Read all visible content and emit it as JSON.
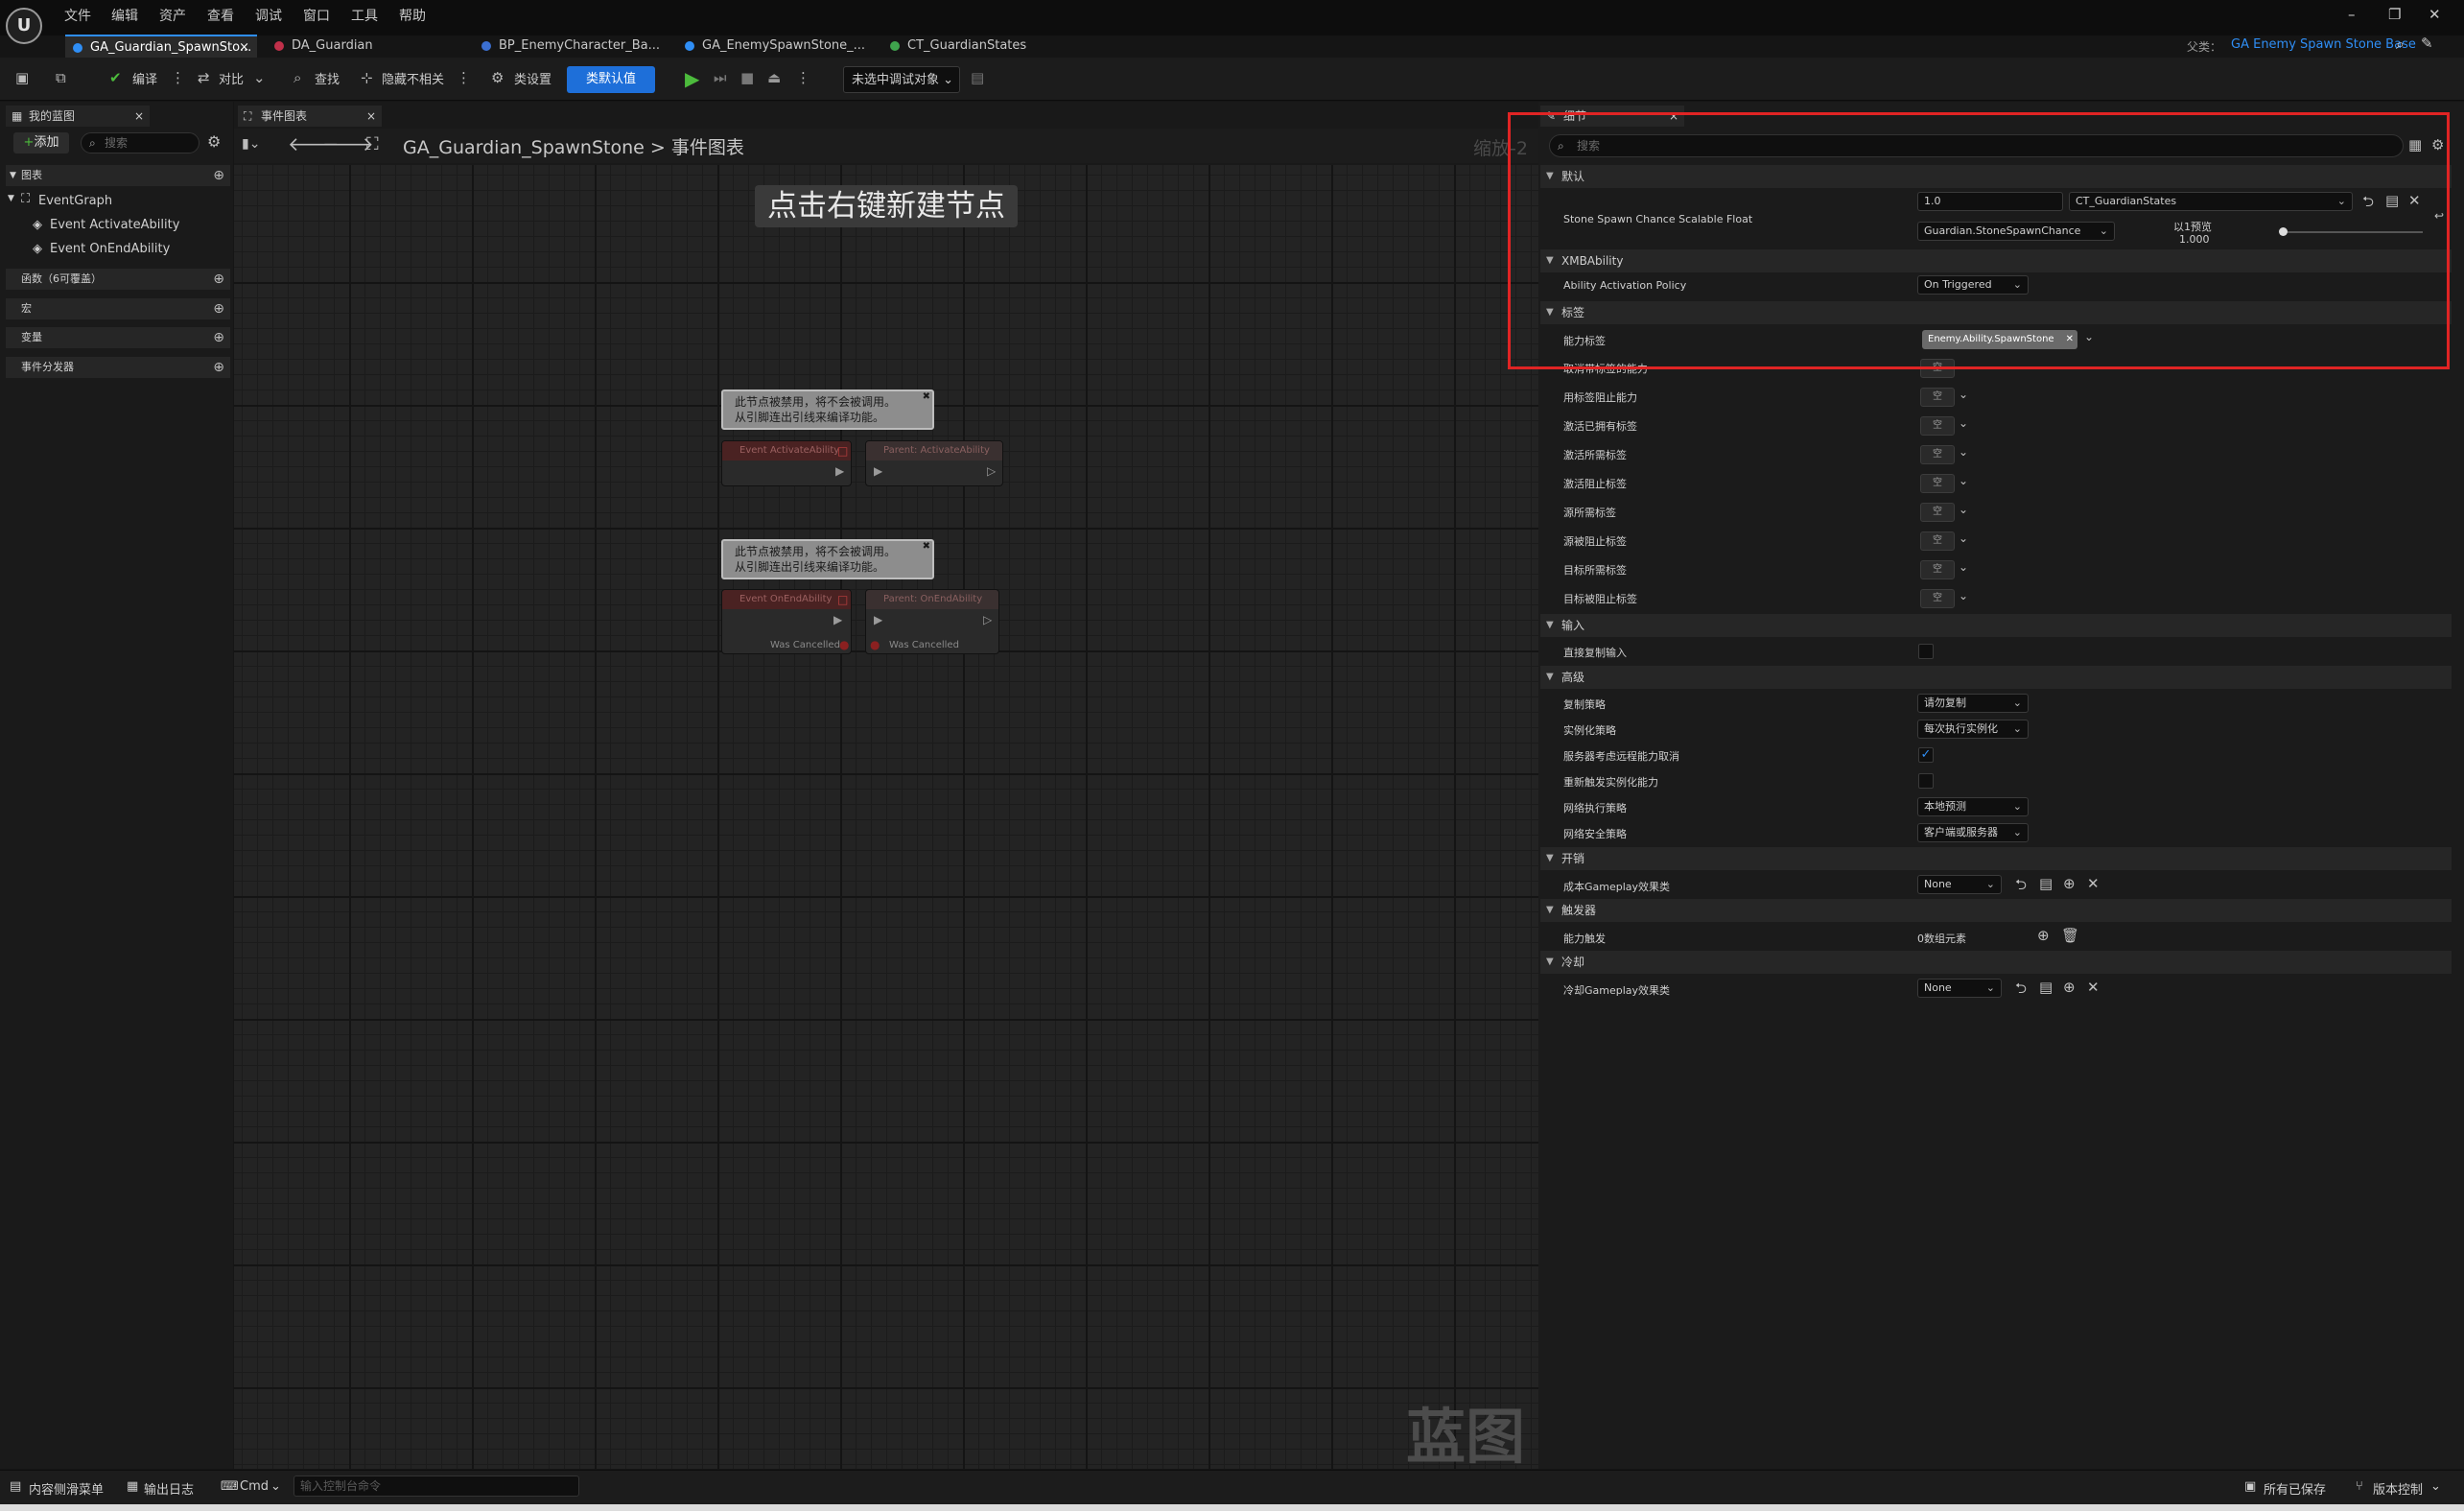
{
  "menu": [
    "文件",
    "编辑",
    "资产",
    "查看",
    "调试",
    "窗口",
    "工具",
    "帮助"
  ],
  "tabs": [
    {
      "label": "GA_Guardian_SpawnSto...",
      "close": "×"
    },
    {
      "label": "DA_Guardian"
    },
    {
      "label": "BP_EnemyCharacter_Ba..."
    },
    {
      "label": "GA_EnemySpawnStone_..."
    },
    {
      "label": "CT_GuardianStates"
    }
  ],
  "parent": {
    "label": "父类：",
    "value": "GA Enemy Spawn Stone Base"
  },
  "toolbar": {
    "compile": "编译",
    "diff": "对比",
    "find": "查找",
    "hide_unrelated": "隐藏不相关",
    "class_settings": "类设置",
    "class_defaults": "类默认值",
    "debug_target": "未选中调试对象"
  },
  "left": {
    "tab": "我的蓝图",
    "add": "添加",
    "search_placeholder": "搜索",
    "graphs": "图表",
    "event_graph": "EventGraph",
    "events": [
      "Event ActivateAbility",
      "Event OnEndAbility"
    ],
    "functions": "函数（6可覆盖）",
    "macros": "宏",
    "variables": "变量",
    "dispatchers": "事件分发器"
  },
  "graph": {
    "tab": "事件图表",
    "breadcrumb_bp": "GA_Guardian_SpawnStone",
    "breadcrumb_sep": ">",
    "breadcrumb_graph": "事件图表",
    "zoom": "缩放-2",
    "hint": "点击右键新建节点",
    "watermark": "蓝图",
    "comment_line1": "此节点被禁用，将不会被调用。",
    "comment_line2": "从引脚连出引线来编译功能。",
    "node1": "Event ActivateAbility",
    "node2": "Parent: ActivateAbility",
    "node3": "Event OnEndAbility",
    "node4": "Parent: OnEndAbility",
    "was_cancelled": "Was Cancelled"
  },
  "details": {
    "tab": "细节",
    "search_placeholder": "搜索",
    "sec_default": "默认",
    "stone_label": "Stone Spawn Chance Scalable Float",
    "stone_value": "1.0",
    "curve_table": "CT_GuardianStates",
    "curve_row": "Guardian.StoneSpawnChance",
    "preview_label": "以1预览",
    "preview_value": "1.000",
    "sec_xmb": "XMBAbility",
    "policy_label": "Ability Activation Policy",
    "policy_value": "On Triggered",
    "sec_tags": "标签",
    "ability_tags_label": "能力标签",
    "ability_tag_value": "Enemy.Ability.SpawnStone",
    "tag_rows": [
      "取消带标签的能力",
      "用标签阻止能力",
      "激活已拥有标签",
      "激活所需标签",
      "激活阻止标签",
      "源所需标签",
      "源被阻止标签",
      "目标所需标签",
      "目标被阻止标签"
    ],
    "empty": "空",
    "sec_input": "输入",
    "input_row": "直接复制输入",
    "sec_advanced": "高级",
    "adv_replication": "复制策略",
    "adv_replication_val": "请勿复制",
    "adv_instancing": "实例化策略",
    "adv_instancing_val": "每次执行实例化",
    "adv_server_cancel": "服务器考虑远程能力取消",
    "adv_retrigger": "重新触发实例化能力",
    "adv_net_exec": "网络执行策略",
    "adv_net_exec_val": "本地预测",
    "adv_net_security": "网络安全策略",
    "adv_net_security_val": "客户端或服务器",
    "sec_cost": "开销",
    "cost_label": "成本Gameplay效果类",
    "cost_value": "None",
    "sec_trigger": "触发器",
    "trigger_label": "能力触发",
    "trigger_value": "0数组元素",
    "sec_cooldown": "冷却",
    "cooldown_label": "冷却Gameplay效果类",
    "cooldown_value": "None"
  },
  "status": {
    "content_drawer": "内容侧滑菜单",
    "output_log": "输出日志",
    "cmd": "Cmd",
    "cmd_placeholder": "输入控制台命令",
    "saved": "所有已保存",
    "source_control": "版本控制"
  },
  "colors": {
    "accent": "#2f8ef5",
    "class_defaults_bg": "#1e6fd9",
    "highlight": "#e02424",
    "play": "#4cbb3c"
  }
}
